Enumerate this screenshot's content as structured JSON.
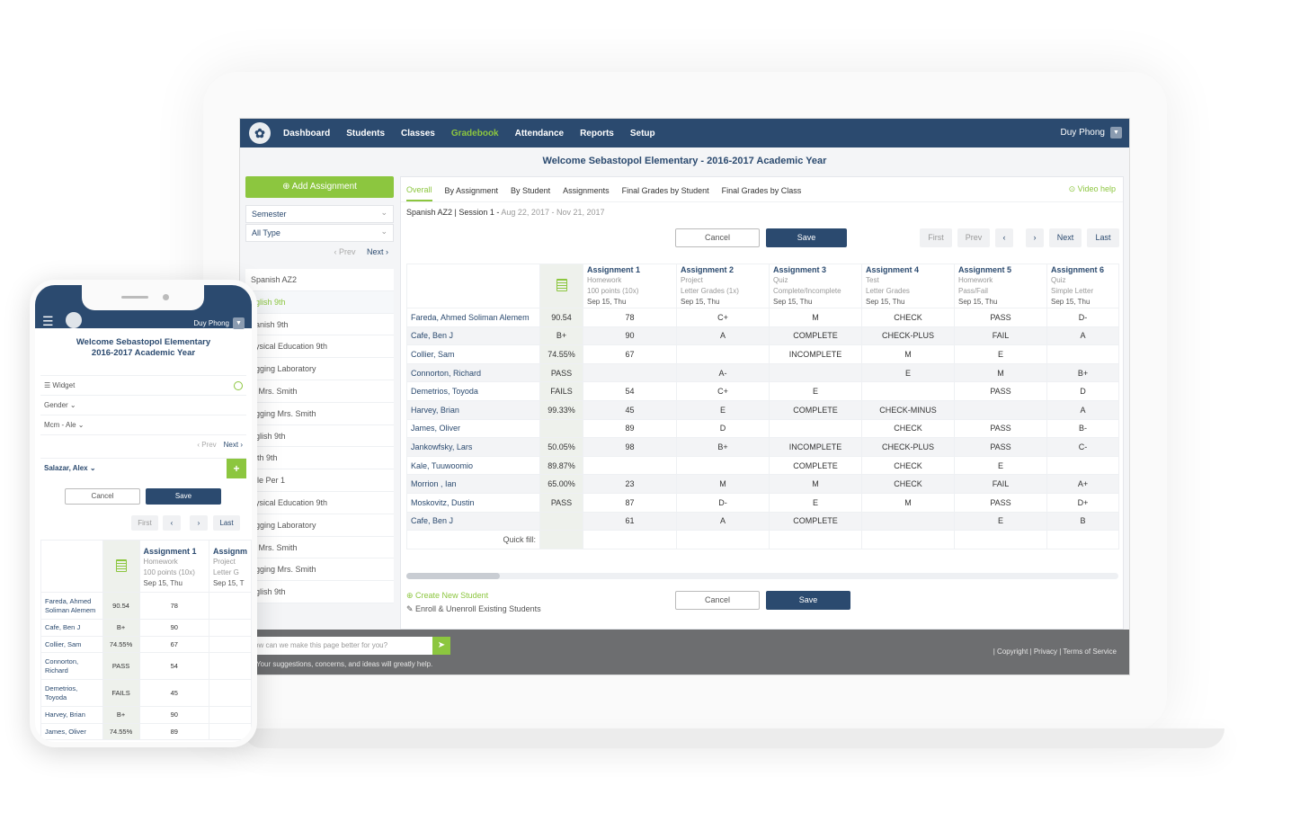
{
  "nav": {
    "items": [
      "Dashboard",
      "Students",
      "Classes",
      "Gradebook",
      "Attendance",
      "Reports",
      "Setup"
    ],
    "active": "Gradebook",
    "user": "Duy Phong"
  },
  "welcome": "Welcome Sebastopol Elementary  -  2016-2017 Academic Year",
  "sidebar": {
    "add_assignment": "Add Assignment",
    "semester": "Semester",
    "type": "All Type",
    "prev": "Prev",
    "next": "Next",
    "classes": [
      "Spanish AZ2",
      "nglish 9th",
      "panish 9th",
      "hysical Education 9th",
      "ogging Laboratory",
      "E Mrs. Smith",
      "ogging Mrs. Smith",
      "nglish 9th",
      "lath 9th",
      "ible Per 1",
      "hysical Education 9th",
      "ogging Laboratory",
      "E Mrs. Smith",
      "ogging Mrs. Smith",
      "nglish 9th"
    ]
  },
  "tabs": [
    "Overall",
    "By Assignment",
    "By Student",
    "Assignments",
    "Final Grades by Student",
    "Final Grades by Class"
  ],
  "video_help": "Video help",
  "session": {
    "label": "Spanish AZ2  |  Session 1 - ",
    "dates": "Aug 22, 2017 - Nov 21, 2017"
  },
  "buttons": {
    "cancel": "Cancel",
    "save": "Save"
  },
  "pagination": {
    "first": "First",
    "prev": "Prev",
    "left": "‹",
    "right": "›",
    "next": "Next",
    "last": "Last"
  },
  "assignments": [
    {
      "title": "Assignment 1",
      "type": "Homework",
      "grading": "100 points (10x)",
      "date": "Sep 15, Thu"
    },
    {
      "title": "Assignment 2",
      "type": "Project",
      "grading": "Letter Grades (1x)",
      "date": "Sep 15, Thu"
    },
    {
      "title": "Assignment 3",
      "type": "Quiz",
      "grading": "Complete/Incomplete",
      "date": "Sep 15, Thu"
    },
    {
      "title": "Assignment 4",
      "type": "Test",
      "grading": "Letter Grades",
      "date": "Sep 15, Thu"
    },
    {
      "title": "Assignment 5",
      "type": "Homework",
      "grading": "Pass/Fail",
      "date": "Sep 15, Thu"
    },
    {
      "title": "Assignment 6",
      "type": "Quiz",
      "grading": "Simple Letter",
      "date": "Sep 15, Thu"
    }
  ],
  "students": [
    {
      "name": "Fareda, Ahmed Soliman Alemem",
      "total": "90.54",
      "g": [
        "78",
        "C+",
        "M",
        "CHECK",
        "PASS",
        "D-"
      ]
    },
    {
      "name": "Cafe, Ben J",
      "total": "B+",
      "g": [
        "90",
        "A",
        "COMPLETE",
        "CHECK-PLUS",
        "FAIL",
        "A"
      ]
    },
    {
      "name": "Collier, Sam",
      "total": "74.55%",
      "g": [
        "67",
        "",
        "INCOMPLETE",
        "M",
        "E",
        ""
      ]
    },
    {
      "name": "Connorton, Richard",
      "total": "PASS",
      "g": [
        "",
        "A-",
        "",
        "E",
        "M",
        "B+"
      ]
    },
    {
      "name": "Demetrios, Toyoda",
      "total": "FAILS",
      "g": [
        "54",
        "C+",
        "E",
        "",
        "PASS",
        "D"
      ]
    },
    {
      "name": "Harvey, Brian",
      "total": "99.33%",
      "g": [
        "45",
        "E",
        "COMPLETE",
        "CHECK-MINUS",
        "",
        "A"
      ]
    },
    {
      "name": "James, Oliver",
      "total": "",
      "g": [
        "89",
        "D",
        "",
        "CHECK",
        "PASS",
        "B-"
      ]
    },
    {
      "name": "Jankowfsky, Lars",
      "total": "50.05%",
      "g": [
        "98",
        "B+",
        "INCOMPLETE",
        "CHECK-PLUS",
        "PASS",
        "C-"
      ]
    },
    {
      "name": "Kale, Tuuwoomio",
      "total": "89.87%",
      "g": [
        "",
        "",
        "COMPLETE",
        "CHECK",
        "E",
        ""
      ]
    },
    {
      "name": "Morrion , Ian",
      "total": "65.00%",
      "g": [
        "23",
        "M",
        "M",
        "CHECK",
        "FAIL",
        "A+"
      ]
    },
    {
      "name": "Moskovitz, Dustin",
      "total": "PASS",
      "g": [
        "87",
        "D-",
        "E",
        "M",
        "PASS",
        "D+"
      ]
    },
    {
      "name": "Cafe, Ben J",
      "total": "",
      "g": [
        "61",
        "A",
        "COMPLETE",
        "",
        "E",
        "B"
      ]
    }
  ],
  "quick_fill": "Quick fill:",
  "create_student": "Create New Student",
  "enroll": "Enroll & Unenroll Existing Students",
  "footer": {
    "placeholder": "ow can we make this page better for you?",
    "sub": "Your suggestions, concerns, and ideas will greatly help.",
    "links": "| Copyright | Privacy | Terms of Service"
  },
  "phone": {
    "user": "Duy Phong",
    "welcome1": "Welcome Sebastopol Elementary",
    "welcome2": "2016-2017 Academic Year",
    "widget": "Widget",
    "gender": "Gender",
    "mcm": "Mcm - Ale",
    "prev": "Prev",
    "next": "Next",
    "student": "Salazar, Alex",
    "cancel": "Cancel",
    "save": "Save",
    "first": "First",
    "last": "Last",
    "a1": {
      "title": "Assignment 1",
      "type": "Homework",
      "grading": "100 points (10x)",
      "date": "Sep 15, Thu"
    },
    "a2": {
      "title": "Assignm",
      "type": "Project",
      "grading": "Letter G",
      "date": "Sep 15, T"
    },
    "rows": [
      {
        "name": "Fareda, Ahmed Soliman Alemem",
        "total": "90.54",
        "a1": "78"
      },
      {
        "name": "Cafe, Ben J",
        "total": "B+",
        "a1": "90"
      },
      {
        "name": "Collier, Sam",
        "total": "74.55%",
        "a1": "67"
      },
      {
        "name": "Connorton, Richard",
        "total": "PASS",
        "a1": "54"
      },
      {
        "name": "Demetrios, Toyoda",
        "total": "FAILS",
        "a1": "45"
      },
      {
        "name": "Harvey, Brian",
        "total": "B+",
        "a1": "90"
      },
      {
        "name": "James, Oliver",
        "total": "74.55%",
        "a1": "89"
      }
    ]
  },
  "colors": {
    "navy": "#2b4a6f",
    "green": "#8cc63f"
  }
}
